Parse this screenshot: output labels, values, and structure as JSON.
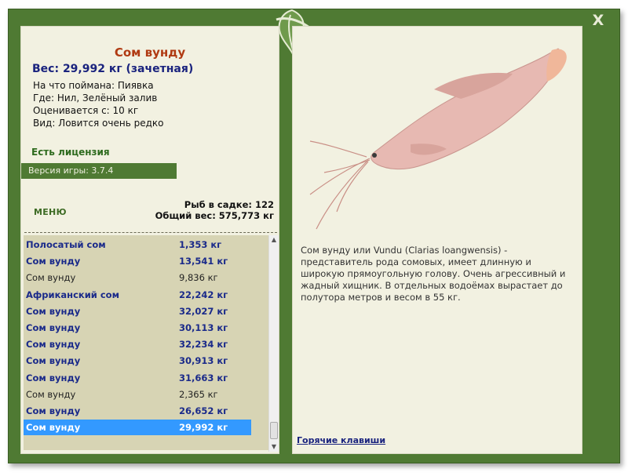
{
  "window": {
    "close_label": "X"
  },
  "fish": {
    "title": "Сом вунду",
    "weight_line": "Вес: 29,992 кг (зачетная)",
    "caught_on": "На что поймана: Пиявка",
    "location": "Где: Нил, Зелёный залив",
    "scored_from": "Оценивается с: 10 кг",
    "rarity": "Вид: Ловится очень редко",
    "description": "Сом вунду или Vundu (Clarias loangwensis) - представитель рода сомовых, имеет длинную и широкую прямоугольную голову. Очень агрессивный и жадный хищник. В отдельных водоёмах вырастает до полутора метров и весом в 55 кг."
  },
  "license": "Есть лицензия",
  "version": "Версия игры: 3.7.4",
  "menu_label": "МЕНЮ",
  "stats": {
    "fish_in_keepnet": "Рыб в садке: 122",
    "total_weight": "Общий вес: 575,773 кг"
  },
  "catch_list": [
    {
      "name": "Полосатый сом",
      "weight": "1,353 кг",
      "bold": true
    },
    {
      "name": "Сом вунду",
      "weight": "13,541 кг",
      "bold": true
    },
    {
      "name": "Сом вунду",
      "weight": "9,836 кг",
      "bold": false
    },
    {
      "name": "Африканский сом",
      "weight": "22,242 кг",
      "bold": true
    },
    {
      "name": "Сом вунду",
      "weight": "32,027 кг",
      "bold": true
    },
    {
      "name": "Сом вунду",
      "weight": "30,113 кг",
      "bold": true
    },
    {
      "name": "Сом вунду",
      "weight": "32,234 кг",
      "bold": true
    },
    {
      "name": "Сом вунду",
      "weight": "30,913 кг",
      "bold": true
    },
    {
      "name": "Сом вунду",
      "weight": "31,663 кг",
      "bold": true
    },
    {
      "name": "Сом вунду",
      "weight": "2,365 кг",
      "bold": false
    },
    {
      "name": "Сом вунду",
      "weight": "26,652 кг",
      "bold": true
    },
    {
      "name": "Сом вунду",
      "weight": "29,992 кг",
      "bold": true,
      "selected": true
    }
  ],
  "hotkeys_label": "Горячие клавиши",
  "colors": {
    "frame_green": "#4f7a33",
    "panel_bg": "#f2f1e1",
    "title_red": "#b03a12",
    "selected_blue": "#3399ff"
  }
}
